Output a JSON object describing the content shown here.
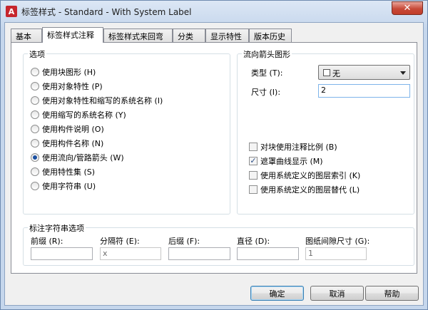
{
  "window": {
    "title": "标签样式 - Standard - With System Label",
    "app_icon": "A",
    "close_glyph": "✕"
  },
  "tabs": [
    {
      "label": "基本",
      "active": false
    },
    {
      "label": "标签样式注释",
      "active": true
    },
    {
      "label": "标签样式来回弯",
      "active": false
    },
    {
      "label": "分类",
      "active": false
    },
    {
      "label": "显示特性",
      "active": false
    },
    {
      "label": "版本历史",
      "active": false
    }
  ],
  "options": {
    "title": "选项",
    "radios": [
      {
        "label": "使用块图形 (H)",
        "checked": false
      },
      {
        "label": "使用对象特性 (P)",
        "checked": false
      },
      {
        "label": "使用对象特性和缩写的系统名称 (I)",
        "checked": false
      },
      {
        "label": "使用缩写的系统名称 (Y)",
        "checked": false
      },
      {
        "label": "使用构件说明 (O)",
        "checked": false
      },
      {
        "label": "使用构件名称 (N)",
        "checked": false
      },
      {
        "label": "使用流向/管路箭头 (W)",
        "checked": true
      },
      {
        "label": "使用特性集 (S)",
        "checked": false
      },
      {
        "label": "使用字符串 (U)",
        "checked": false
      }
    ]
  },
  "flow_arrow": {
    "title": "流向箭头图形",
    "type_label": "类型 (T):",
    "type_value": "无",
    "size_label": "尺寸 (I):",
    "size_value": "2",
    "checkboxes": [
      {
        "label": "对块使用注释比例 (B)",
        "checked": false
      },
      {
        "label": "遮罩曲线显示 (M)",
        "checked": true
      },
      {
        "label": "使用系统定义的图层索引 (K)",
        "checked": false
      },
      {
        "label": "使用系统定义的图层替代 (L)",
        "checked": false
      }
    ]
  },
  "string_options": {
    "title": "标注字符串选项",
    "fields": [
      {
        "label": "前缀 (R):",
        "value": ""
      },
      {
        "label": "分隔符 (E):",
        "value": "x"
      },
      {
        "label": "后缀 (F):",
        "value": ""
      },
      {
        "label": "直径 (D):",
        "value": ""
      },
      {
        "label": "图纸间隙尺寸 (G):",
        "value": "1"
      }
    ]
  },
  "buttons": {
    "ok": "确定",
    "cancel": "取消",
    "help": "帮助"
  }
}
